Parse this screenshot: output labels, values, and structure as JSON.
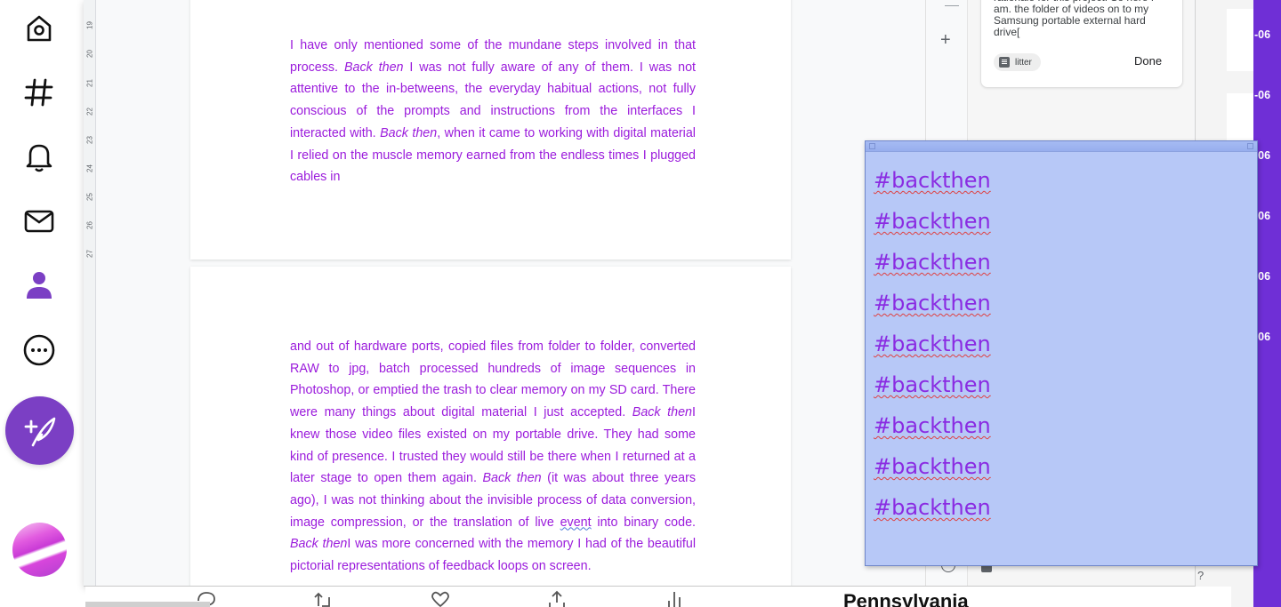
{
  "sidebar": {
    "icons": [
      "home-icon",
      "hashtag-icon",
      "bell-icon",
      "mail-icon",
      "profile-icon",
      "more-icon"
    ],
    "compose_icon": "feather-plus-icon",
    "accent": "#7b3fc4"
  },
  "ruler": {
    "numbers": [
      "19",
      "20",
      "21",
      "22",
      "23",
      "24",
      "25",
      "26",
      "27"
    ]
  },
  "document": {
    "text_color": "#9b1bdc",
    "page1_paragraph": [
      {
        "t": "I have only mentioned some of the mundane steps involved in that process. "
      },
      {
        "t": "Back then",
        "i": true
      },
      {
        "t": " I was not fully aware of any of them. I was not attentive to the in-betweens, the everyday habitual actions, not fully conscious of the prompts and instructions from the interfaces I interacted with. "
      },
      {
        "t": "Back then",
        "i": true
      },
      {
        "t": ", when it came to working with digital material I relied on the muscle memory earned from the endless times I plugged cables in"
      }
    ],
    "page2_paragraph": [
      {
        "t": "and out of hardware ports, copied files from folder to folder, converted RAW to jpg, batch processed hundreds of image sequences in Photoshop, or emptied the trash to clear memory on my SD card. There were many things about digital material I just accepted. "
      },
      {
        "t": "Back then",
        "i": true
      },
      {
        "t": "I knew those video files existed on my portable drive. They had some kind of presence. I trusted they would still be there when I returned at a later stage to open them again. "
      },
      {
        "t": "Back then",
        "i": true
      },
      {
        "t": " (it was about three years ago), I was not thinking about the invisible process of data conversion, image compression, or the translation of live "
      },
      {
        "t": "event",
        "u": true
      },
      {
        "t": " into binary code. "
      },
      {
        "t": "Back then",
        "i": true
      },
      {
        "t": "I was more concerned with the memory I had of the beautiful pictorial representations of feedback loops on screen."
      }
    ]
  },
  "keep_note": {
    "text": "rationale for this project. So here I am. the folder of videos on to my Samsung portable external hard drive[",
    "chip_label": "litter",
    "done_label": "Done"
  },
  "side_panel": {
    "add_symbol": "+"
  },
  "sticky_note": {
    "lines": [
      "#backthen",
      "#backthen",
      "#backthen",
      "#backthen",
      "#backthen",
      "#backthen",
      "#backthen",
      "#backthen",
      "#backthen"
    ],
    "background": "#b7c8f7",
    "text_color": "#8a2be2"
  },
  "purple_strip": {
    "labels": [
      "-06",
      "-06",
      "-06",
      "-06",
      "-06",
      "-06"
    ],
    "color": "#6f2fd6"
  },
  "bottom": {
    "heading": "Pennsylvania",
    "action_icons": [
      "reply-icon",
      "retweet-icon",
      "like-icon",
      "share-icon",
      "analytics-icon"
    ],
    "help_symbol": "?"
  }
}
